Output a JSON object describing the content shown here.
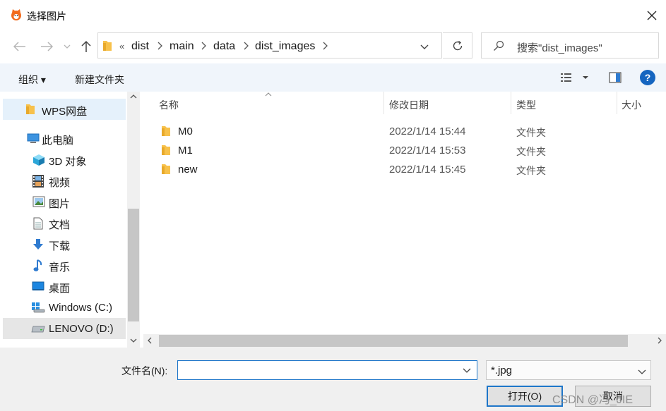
{
  "window": {
    "title": "选择图片",
    "app_icon": "fox-app-icon",
    "close_glyph": "✕"
  },
  "navigation": {
    "overflow_glyph": "«",
    "breadcrumbs": [
      "dist",
      "main",
      "data",
      "dist_images"
    ],
    "search_placeholder": "搜索\"dist_images\""
  },
  "toolbar": {
    "organize_label": "组织 ▾",
    "new_folder_label": "新建文件夹",
    "help_label": "?"
  },
  "sidebar": {
    "items": [
      {
        "label": "WPS网盘",
        "icon": "folder-icon"
      },
      {
        "label": "此电脑",
        "icon": "computer-icon"
      },
      {
        "label": "3D 对象",
        "icon": "cube-icon"
      },
      {
        "label": "视频",
        "icon": "film-icon"
      },
      {
        "label": "图片",
        "icon": "picture-icon"
      },
      {
        "label": "文档",
        "icon": "document-icon"
      },
      {
        "label": "下载",
        "icon": "download-arrow-icon"
      },
      {
        "label": "音乐",
        "icon": "music-note-icon"
      },
      {
        "label": "桌面",
        "icon": "desktop-icon"
      },
      {
        "label": "Windows (C:)",
        "icon": "windows-drive-icon"
      },
      {
        "label": "LENOVO (D:)",
        "icon": "drive-icon"
      }
    ]
  },
  "file_list": {
    "columns": [
      "名称",
      "修改日期",
      "类型",
      "大小"
    ],
    "rows": [
      {
        "name": "M0",
        "date": "2022/1/14 15:44",
        "type": "文件夹"
      },
      {
        "name": "M1",
        "date": "2022/1/14 15:53",
        "type": "文件夹"
      },
      {
        "name": "new",
        "date": "2022/1/14 15:45",
        "type": "文件夹"
      }
    ]
  },
  "footer": {
    "filename_label": "文件名(N):",
    "filename_value": "",
    "filetype_value": "*.jpg",
    "open_label": "打开(O)",
    "cancel_label": "取消"
  },
  "watermark": "CSDN @冯_JIE",
  "colors": {
    "accent": "#1e76c9",
    "folder": "#f7c14b",
    "selected_nav": "#e5f1fb",
    "help_blue": "#1565c0"
  }
}
